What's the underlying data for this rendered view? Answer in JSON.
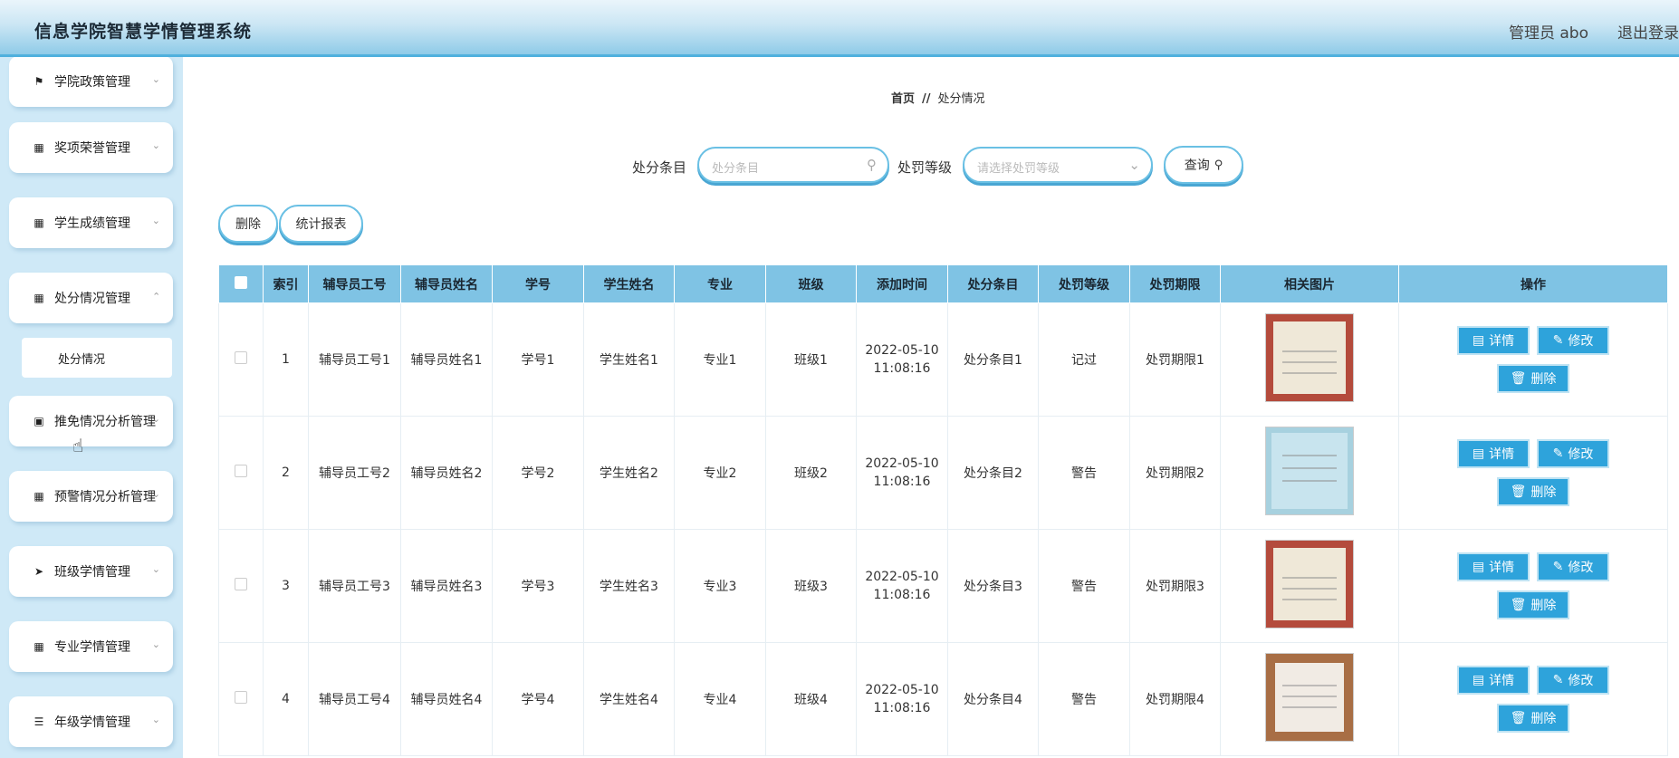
{
  "header": {
    "title": "信息学院智慧学情管理系统",
    "admin": "管理员 abo",
    "logout": "退出登录"
  },
  "sidebar": {
    "items": [
      {
        "label": "学院政策管理",
        "icon": "⚑"
      },
      {
        "label": "奖项荣誉管理",
        "icon": "▦"
      },
      {
        "label": "学生成绩管理",
        "icon": "▦"
      },
      {
        "label": "处分情况管理",
        "icon": "▦"
      },
      {
        "label": "推免情况分析管理",
        "icon": "▣"
      },
      {
        "label": "预警情况分析管理",
        "icon": "▦"
      },
      {
        "label": "班级学情管理",
        "icon": "➤"
      },
      {
        "label": "专业学情管理",
        "icon": "▦"
      },
      {
        "label": "年级学情管理",
        "icon": "☰"
      }
    ],
    "chevron": "⌄",
    "sub_item": "处分情况"
  },
  "breadcrumb": {
    "home": "首页",
    "sep": "//",
    "current": "处分情况"
  },
  "search": {
    "label1": "处分条目",
    "placeholder1": "处分条目",
    "label2": "处罚等级",
    "placeholder2": "请选择处罚等级",
    "button": "查询"
  },
  "actions": {
    "delete": "删除",
    "report": "统计报表"
  },
  "table": {
    "headers": [
      "索引",
      "辅导员工号",
      "辅导员姓名",
      "学号",
      "学生姓名",
      "专业",
      "班级",
      "添加时间",
      "处分条目",
      "处罚等级",
      "处罚期限",
      "相关图片",
      "操作"
    ],
    "rows": [
      {
        "index": "1",
        "teacher_id": "辅导员工号1",
        "teacher_name": "辅导员姓名1",
        "student_id": "学号1",
        "student_name": "学生姓名1",
        "major": "专业1",
        "class": "班级1",
        "date": "2022-05-10",
        "time": "11:08:16",
        "item": "处分条目1",
        "level": "记过",
        "period": "处罚期限1"
      },
      {
        "index": "2",
        "teacher_id": "辅导员工号2",
        "teacher_name": "辅导员姓名2",
        "student_id": "学号2",
        "student_name": "学生姓名2",
        "major": "专业2",
        "class": "班级2",
        "date": "2022-05-10",
        "time": "11:08:16",
        "item": "处分条目2",
        "level": "警告",
        "period": "处罚期限2"
      },
      {
        "index": "3",
        "teacher_id": "辅导员工号3",
        "teacher_name": "辅导员姓名3",
        "student_id": "学号3",
        "student_name": "学生姓名3",
        "major": "专业3",
        "class": "班级3",
        "date": "2022-05-10",
        "time": "11:08:16",
        "item": "处分条目3",
        "level": "警告",
        "period": "处罚期限3"
      },
      {
        "index": "4",
        "teacher_id": "辅导员工号4",
        "teacher_name": "辅导员姓名4",
        "student_id": "学号4",
        "student_name": "学生姓名4",
        "major": "专业4",
        "class": "班级4",
        "date": "2022-05-10",
        "time": "11:08:16",
        "item": "处分条目4",
        "level": "警告",
        "period": "处罚期限4"
      }
    ],
    "ops": {
      "detail": "详情",
      "edit": "修改",
      "remove": "删除"
    }
  },
  "colors": {
    "accent": "#2ea3db",
    "header_bg": "#7fc3e4",
    "sidebar_bg": "#cfe9f7"
  }
}
